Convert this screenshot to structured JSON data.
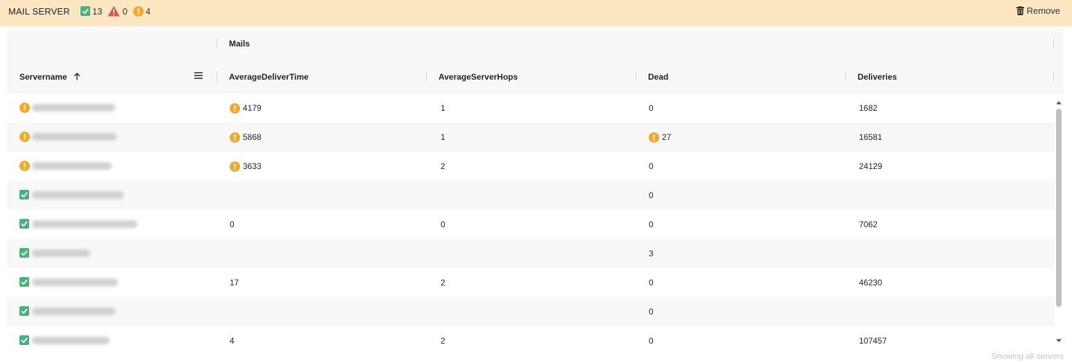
{
  "header": {
    "title": "MAIL SERVER",
    "ok_count": "13",
    "error_count": "0",
    "warning_count": "4",
    "remove_label": "Remove"
  },
  "table": {
    "group_header": "Mails",
    "columns": {
      "servername": "Servername",
      "avg_deliver_time": "AverageDeliverTime",
      "avg_server_hops": "AverageServerHops",
      "dead": "Dead",
      "deliveries": "Deliveries"
    },
    "rows": [
      {
        "status": "warning",
        "avg_deliver_time": "4179",
        "avg_deliver_warn": true,
        "avg_server_hops": "1",
        "dead": "0",
        "dead_warn": false,
        "deliveries": "1682"
      },
      {
        "status": "warning",
        "avg_deliver_time": "5868",
        "avg_deliver_warn": true,
        "avg_server_hops": "1",
        "dead": "27",
        "dead_warn": true,
        "deliveries": "16581"
      },
      {
        "status": "warning",
        "avg_deliver_time": "3633",
        "avg_deliver_warn": true,
        "avg_server_hops": "2",
        "dead": "0",
        "dead_warn": false,
        "deliveries": "24129"
      },
      {
        "status": "ok",
        "avg_deliver_time": "",
        "avg_deliver_warn": false,
        "avg_server_hops": "",
        "dead": "0",
        "dead_warn": false,
        "deliveries": ""
      },
      {
        "status": "ok",
        "avg_deliver_time": "0",
        "avg_deliver_warn": false,
        "avg_server_hops": "0",
        "dead": "0",
        "dead_warn": false,
        "deliveries": "7062"
      },
      {
        "status": "ok",
        "avg_deliver_time": "",
        "avg_deliver_warn": false,
        "avg_server_hops": "",
        "dead": "3",
        "dead_warn": false,
        "deliveries": ""
      },
      {
        "status": "ok",
        "avg_deliver_time": "17",
        "avg_deliver_warn": false,
        "avg_server_hops": "2",
        "dead": "0",
        "dead_warn": false,
        "deliveries": "46230"
      },
      {
        "status": "ok",
        "avg_deliver_time": "",
        "avg_deliver_warn": false,
        "avg_server_hops": "",
        "dead": "0",
        "dead_warn": false,
        "deliveries": ""
      },
      {
        "status": "ok",
        "avg_deliver_time": "4",
        "avg_deliver_warn": false,
        "avg_server_hops": "2",
        "dead": "0",
        "dead_warn": false,
        "deliveries": "107457"
      }
    ]
  },
  "footer": {
    "status_text": "Showing all servers"
  },
  "colors": {
    "banner": "#fde7c2",
    "ok": "#4caf7d",
    "warning": "#f0a830",
    "error": "#d9534f"
  },
  "icons": {
    "ok": "check-icon",
    "warning": "warning-icon",
    "error": "error-triangle-icon",
    "remove": "trash-icon",
    "column_menu": "menu-icon",
    "sort": "arrow-up-icon"
  }
}
